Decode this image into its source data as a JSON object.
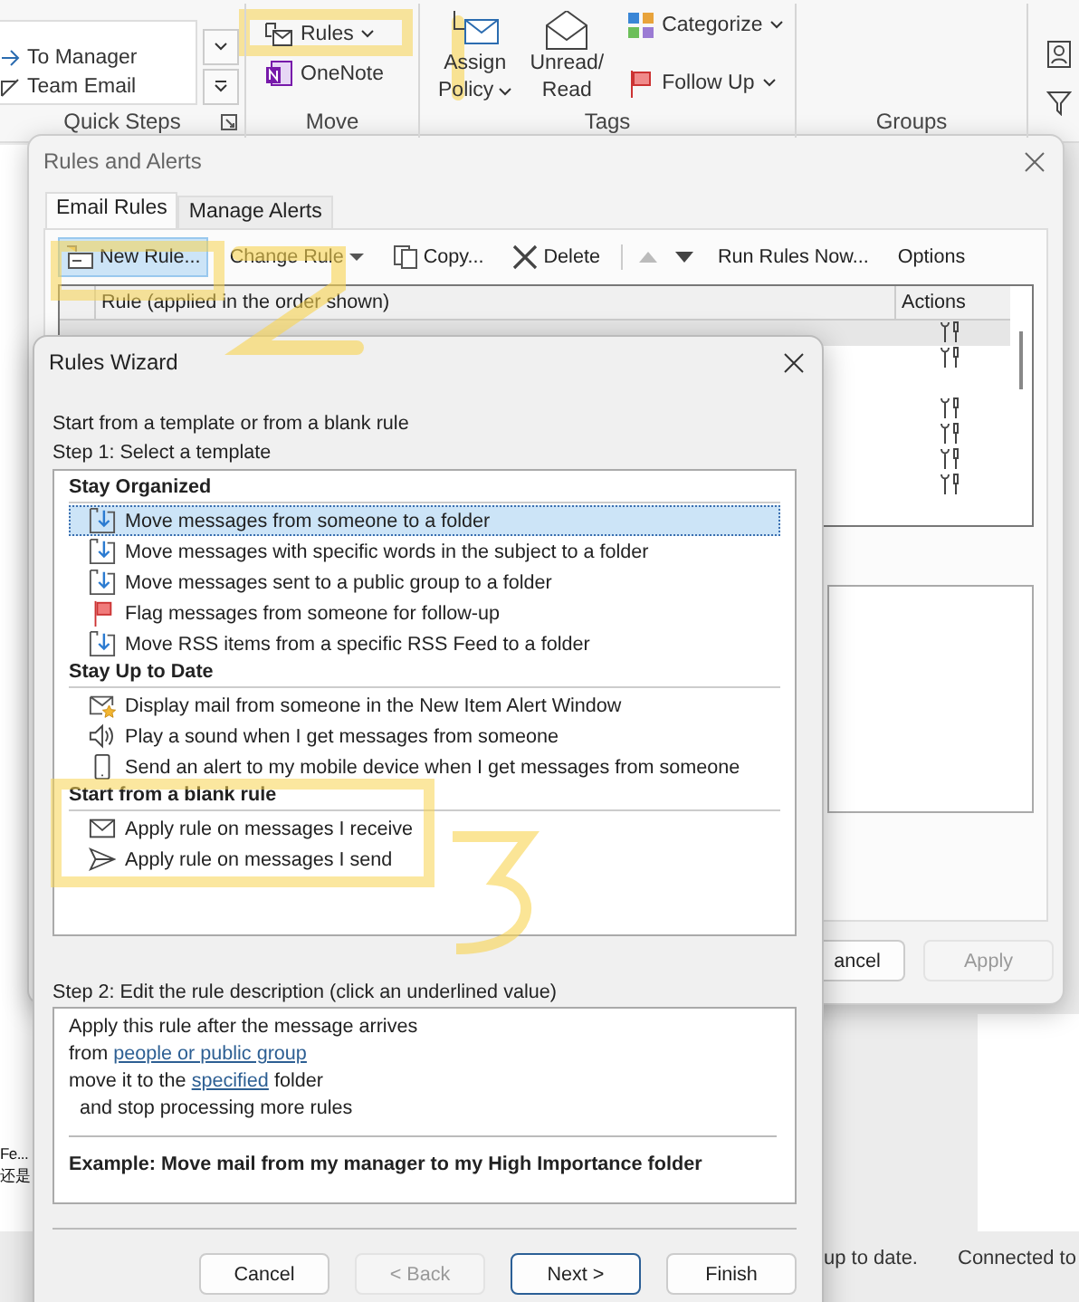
{
  "ribbon": {
    "quick_steps": {
      "items": [
        "To Manager",
        "Team Email"
      ],
      "label": "Quick Steps"
    },
    "move": {
      "items": [
        {
          "label": "Rules",
          "kind": "rules",
          "menu": true
        },
        {
          "label": "OneNote",
          "kind": "onenote",
          "menu": false
        }
      ],
      "label": "Move"
    },
    "tags": {
      "large": [
        {
          "lines": [
            "Assign",
            "Policy"
          ],
          "kind": "policy",
          "menu": true
        },
        {
          "lines": [
            "Unread/",
            "Read"
          ],
          "kind": "unread",
          "menu": false
        }
      ],
      "small": [
        {
          "label": "Categorize",
          "kind": "categorize",
          "menu": true
        },
        {
          "label": "Follow Up",
          "kind": "flag",
          "menu": true
        }
      ],
      "label": "Tags"
    },
    "groups": {
      "label": "Groups"
    }
  },
  "left_pane": [
    "Fe...",
    "还是"
  ],
  "rules_dialog": {
    "title": "Rules and Alerts",
    "tabs": [
      {
        "label": "Email Rules",
        "selected": true
      },
      {
        "label": "Manage Alerts",
        "selected": false
      }
    ],
    "toolbar": [
      {
        "label": "New Rule...",
        "kind": "new",
        "selected": true
      },
      {
        "label": "Change Rule",
        "kind": "change",
        "selected": false
      },
      {
        "label": "Copy...",
        "kind": "copy",
        "selected": false
      },
      {
        "label": "Delete",
        "kind": "delete",
        "selected": false
      }
    ],
    "move_up": {
      "disabled": true
    },
    "move_down": {
      "disabled": false
    },
    "toolbar_end": [
      "Run Rules Now...",
      "Options"
    ],
    "columns": [
      "Rule (applied in the order shown)",
      "Actions"
    ],
    "buttons": [
      {
        "label": "ancel",
        "disabled": false
      },
      {
        "label": "Apply",
        "disabled": true
      }
    ]
  },
  "wizard": {
    "title": "Rules Wizard",
    "intro": "Start from a template or from a blank rule",
    "step1": "Step 1: Select a template",
    "groups": [
      {
        "header": "Stay Organized",
        "items": [
          {
            "label": "Move messages from someone to a folder",
            "kind": "move",
            "selected": true
          },
          {
            "label": "Move messages with specific words in the subject to a folder",
            "kind": "move",
            "selected": false
          },
          {
            "label": "Move messages sent to a public group to a folder",
            "kind": "move",
            "selected": false
          },
          {
            "label": "Flag messages from someone for follow-up",
            "kind": "flag",
            "selected": false
          },
          {
            "label": "Move RSS items from a specific RSS Feed to a folder",
            "kind": "move",
            "selected": false
          }
        ]
      },
      {
        "header": "Stay Up to Date",
        "items": [
          {
            "label": "Display mail from someone in the New Item Alert Window",
            "kind": "alert",
            "selected": false
          },
          {
            "label": "Play a sound when I get messages from someone",
            "kind": "sound",
            "selected": false
          },
          {
            "label": "Send an alert to my mobile device when I get messages from someone",
            "kind": "mobile",
            "selected": false
          }
        ]
      },
      {
        "header": "Start from a blank rule",
        "items": [
          {
            "label": "Apply rule on messages I receive",
            "kind": "receive",
            "selected": false
          },
          {
            "label": "Apply rule on messages I send",
            "kind": "send",
            "selected": false
          }
        ]
      }
    ],
    "step2": "Step 2: Edit the rule description (click an underlined value)",
    "description": [
      {
        "parts": [
          {
            "kind": "text",
            "text": "Apply this rule after the message arrives"
          }
        ]
      },
      {
        "parts": [
          {
            "kind": "text",
            "text": "from "
          },
          {
            "kind": "link",
            "text": "people or public group"
          }
        ]
      },
      {
        "parts": [
          {
            "kind": "text",
            "text": "move it to the "
          },
          {
            "kind": "link",
            "text": "specified"
          },
          {
            "kind": "text",
            "text": " folder"
          }
        ]
      },
      {
        "parts": [
          {
            "kind": "text",
            "text": "  and stop processing more rules"
          }
        ]
      }
    ],
    "example": "Example: Move mail from my manager to my High Importance folder",
    "buttons": [
      {
        "label": "Cancel",
        "disabled": false,
        "default": false
      },
      {
        "label": "< Back",
        "disabled": true,
        "default": false
      },
      {
        "label": "Next >",
        "disabled": false,
        "default": true
      },
      {
        "label": "Finish",
        "disabled": false,
        "default": false
      }
    ]
  },
  "status_bar": [
    "up to date.",
    "Connected to"
  ]
}
